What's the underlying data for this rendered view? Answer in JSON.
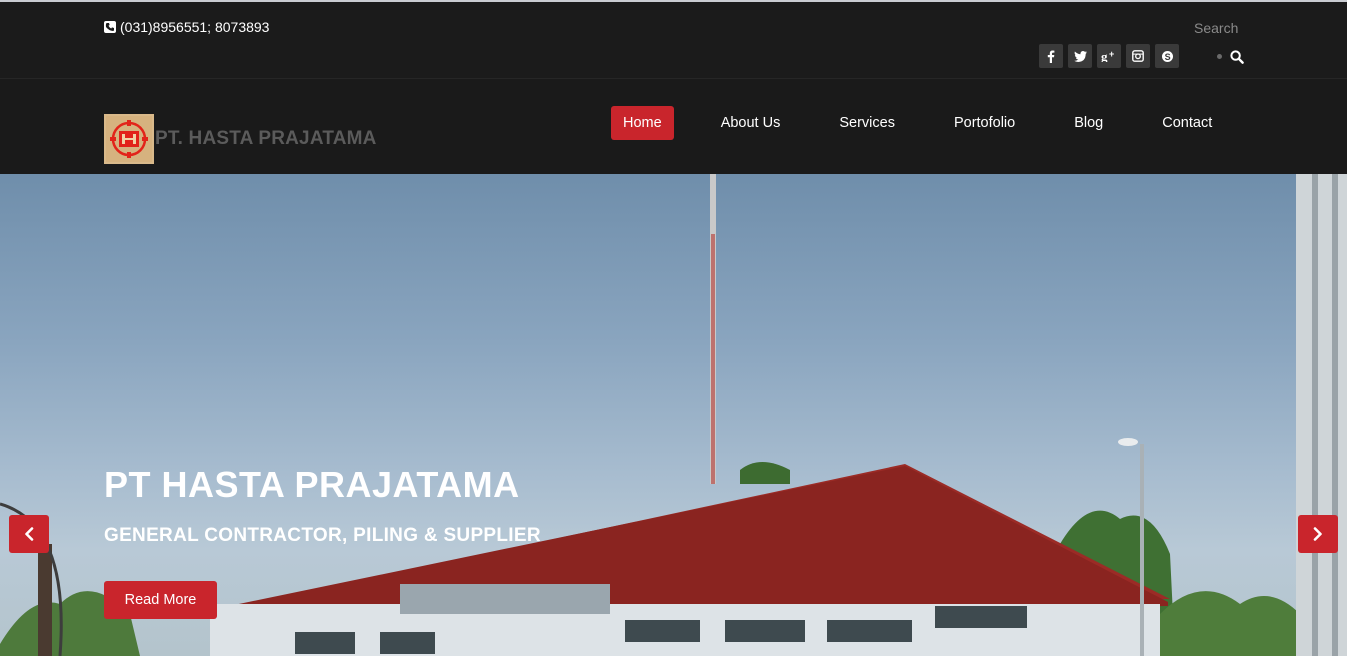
{
  "topbar": {
    "phone": "(031)8956551; 8073893",
    "search_placeholder": "Search",
    "socials": [
      "facebook-icon",
      "twitter-icon",
      "google-plus-icon",
      "instagram-icon",
      "skype-icon"
    ]
  },
  "brand": {
    "name": "PT. HASTA PRAJATAMA"
  },
  "nav": {
    "items": [
      "Home",
      "About Us",
      "Services",
      "Portofolio",
      "Blog",
      "Contact"
    ],
    "active": "Home"
  },
  "hero": {
    "title": "PT HASTA PRAJATAMA",
    "subtitle": "GENERAL CONTRACTOR, PILING & SUPPLIER",
    "button": "Read More"
  },
  "colors": {
    "accent": "#c9252c",
    "bar_background": "#1a1a1a"
  }
}
